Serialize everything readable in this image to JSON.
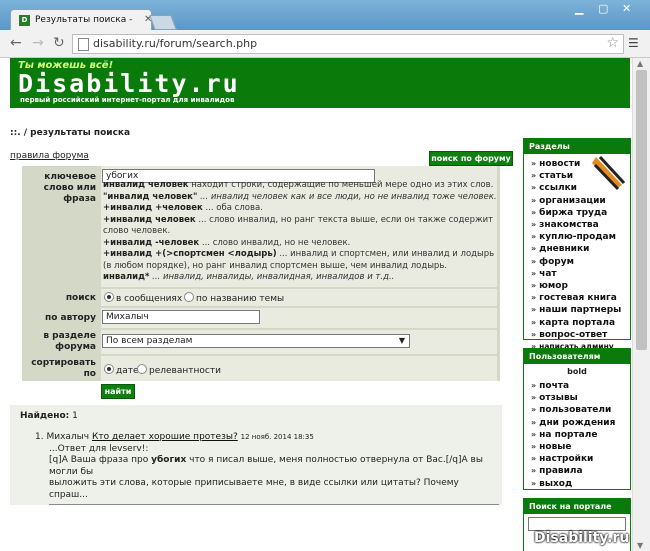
{
  "browser": {
    "tab_title": "Результаты поиска - Disa",
    "favicon": "D",
    "url": "disability.ru/forum/search.php"
  },
  "site": {
    "slogan": "Ты можешь всё!",
    "logo": "Disability.ru",
    "tagline": "первый российский интернет-портал для инвалидов"
  },
  "breadcrumb": "::. / результаты поиска",
  "rules_link": "правила форума",
  "search_button": "поиск по форуму",
  "form": {
    "keyword_label": [
      "ключевое",
      "слово или",
      "фраза"
    ],
    "keyword_value": "убогих",
    "help": [
      {
        "b": "инвалид человек",
        "t": " находит строки, содержащие по меньшей мере одно из этих слов."
      },
      {
        "b": "\"инвалид человек\"",
        "t": " ... инвалид человек как и все люди, но не инвалид тоже человек."
      },
      {
        "b": "+инвалид +человек",
        "t": " ... оба слова."
      },
      {
        "b": "+инвалид человек",
        "t": " ... слово инвалид, но ранг текста выше, если он также содержит слово человек."
      },
      {
        "b": "+инвалид -человек",
        "t": " ... слово инвалид, но не человек."
      },
      {
        "b": "+инвалид +(>спортсмен <лодырь)",
        "t": " ... инвалид и спортсмен, или инвалид и лодырь (в любом порядке), но ранг инвалид спортсмен выше, чем инвалид лодырь."
      },
      {
        "b": "инвалид*",
        "t": " ... инвалид, инвалиды, инвалидная, инвалидов и т.д.."
      }
    ],
    "search_label": "поиск",
    "search_opt1": "в сообщениях",
    "search_opt2": "по названию темы",
    "author_label": "по автору",
    "author_value": "Михалыч",
    "section_label": [
      "в разделе",
      "форума"
    ],
    "section_value": "По всем разделам",
    "sort_label": [
      "сортировать",
      "по"
    ],
    "sort_opt1": "дате",
    "sort_opt2": "релевантности",
    "go_button": "найти"
  },
  "results": {
    "found_label": "Найдено:",
    "found_count": "1",
    "items": [
      {
        "num": "1.",
        "author": "Михалыч",
        "title": "Кто делает хорошие протезы?",
        "date": "12 нояб. 2014 18:35",
        "line1": "...Ответ для levserv!:",
        "line2_pre": "[q]А Ваша фраза про ",
        "line2_hl": "убогих",
        "line2_post": " что я писал выше, меня полностью отвернула от Вас.[/q]А вы могли бы",
        "line3": "выложить эти слова, которые приписываете мне, в виде ссылки или цитаты? Почему спраш..."
      }
    ]
  },
  "sidebar": {
    "sections_title": "Разделы",
    "sections": [
      "новости",
      "статьи",
      "ссылки",
      "организации",
      "биржа труда",
      "знакомства",
      "куплю-продам",
      "дневники",
      "форум",
      "чат",
      "юмор",
      "гостевая книга",
      "наши партнеры",
      "карта портала",
      "вопрос-ответ",
      "написать админу"
    ],
    "users_title": "Пользователям",
    "user_name": "bold",
    "users": [
      "почта",
      "отзывы",
      "пользователи",
      "дни рождения",
      "на портале",
      "новые",
      "настройки",
      "правила",
      "выход"
    ],
    "search_title": "Поиск на портале"
  },
  "watermark": "Disability.ru"
}
